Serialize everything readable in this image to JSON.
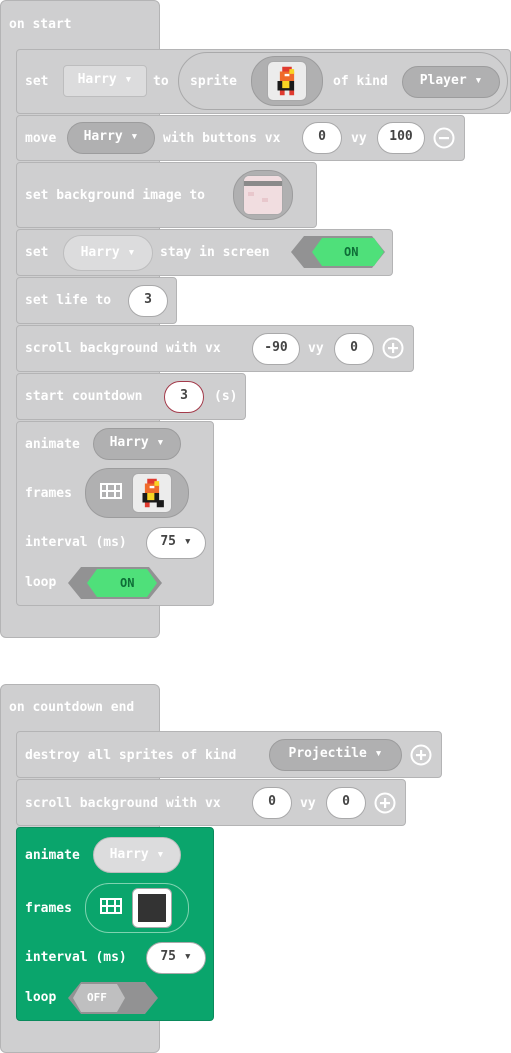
{
  "colors": {
    "block_gray": "#cfcfd0",
    "toggle_on": "#4fe07a",
    "toggle_off_dark": "#929293",
    "animate_green": "#0aa56c"
  },
  "on_start": {
    "label": "on start",
    "set_sprite": {
      "set": "set",
      "var": "Harry",
      "to": "to",
      "sprite": "sprite",
      "of_kind": "of kind",
      "kind": "Player"
    },
    "move": {
      "label": "move",
      "var": "Harry",
      "with_buttons": "with buttons vx",
      "vx": "0",
      "vy_label": "vy",
      "vy": "100",
      "icon": "minus-circle-icon"
    },
    "background": {
      "label": "set background image to"
    },
    "stay": {
      "set": "set",
      "var": "Harry",
      "label": "stay in screen",
      "toggle": "ON"
    },
    "life": {
      "label": "set life to",
      "value": "3"
    },
    "scroll": {
      "label": "scroll background with vx",
      "vx": "-90",
      "vy_label": "vy",
      "vy": "0",
      "icon": "plus-circle-icon"
    },
    "countdown": {
      "label": "start countdown",
      "value": "3",
      "unit": "(s)"
    },
    "animate": {
      "label": "animate",
      "var": "Harry",
      "frames": "frames",
      "interval_label": "interval (ms)",
      "interval": "75",
      "loop": "loop",
      "toggle": "ON"
    }
  },
  "on_countdown_end": {
    "label": "on countdown end",
    "destroy": {
      "label": "destroy all sprites of kind",
      "kind": "Projectile",
      "icon": "plus-circle-icon"
    },
    "scroll": {
      "label": "scroll background with vx",
      "vx": "0",
      "vy_label": "vy",
      "vy": "0",
      "icon": "plus-circle-icon"
    },
    "animate": {
      "label": "animate",
      "var": "Harry",
      "frames": "frames",
      "interval_label": "interval (ms)",
      "interval": "75",
      "loop": "loop",
      "toggle": "OFF"
    }
  }
}
